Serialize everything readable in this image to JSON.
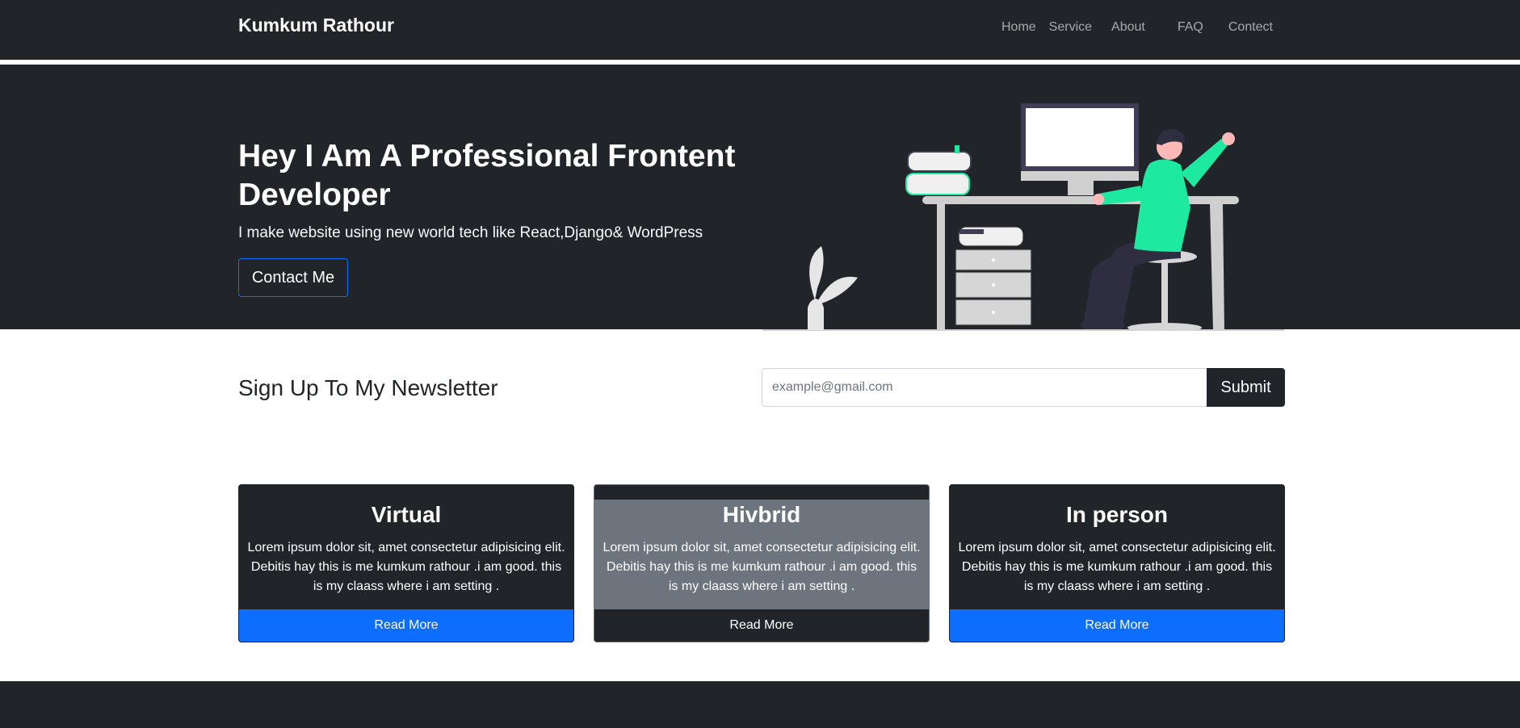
{
  "navbar": {
    "brand": "Kumkum Rathour",
    "links": [
      "Home",
      "Service",
      "About",
      "FAQ",
      "Contect"
    ]
  },
  "hero": {
    "title": "Hey I Am A Professional Frontent Developer",
    "subtitle": "I make website using new world tech like React,Django& WordPress",
    "button": "Contact Me",
    "illustration": "person-at-desk-illustration"
  },
  "newsletter": {
    "title": "Sign Up To My Newsletter",
    "placeholder": "example@gmail.com",
    "submit": "Submit"
  },
  "cards": [
    {
      "title": "Virtual",
      "text": "Lorem ipsum dolor sit, amet consectetur adipisicing elit. Debitis hay this is me kumkum rathour .i am good. this is my claass where i am setting .",
      "button": "Read More"
    },
    {
      "title": "Hivbrid",
      "text": "Lorem ipsum dolor sit, amet consectetur adipisicing elit. Debitis hay this is me kumkum rathour .i am good. this is my claass where i am setting .",
      "button": "Read More"
    },
    {
      "title": "In person",
      "text": "Lorem ipsum dolor sit, amet consectetur adipisicing elit. Debitis hay this is me kumkum rathour .i am good. this is my claass where i am setting .",
      "button": "Read More"
    }
  ],
  "colors": {
    "dark": "#212529",
    "primary": "#0d6efd",
    "secondary": "#6c757d",
    "accent_green": "#1de9a0"
  }
}
